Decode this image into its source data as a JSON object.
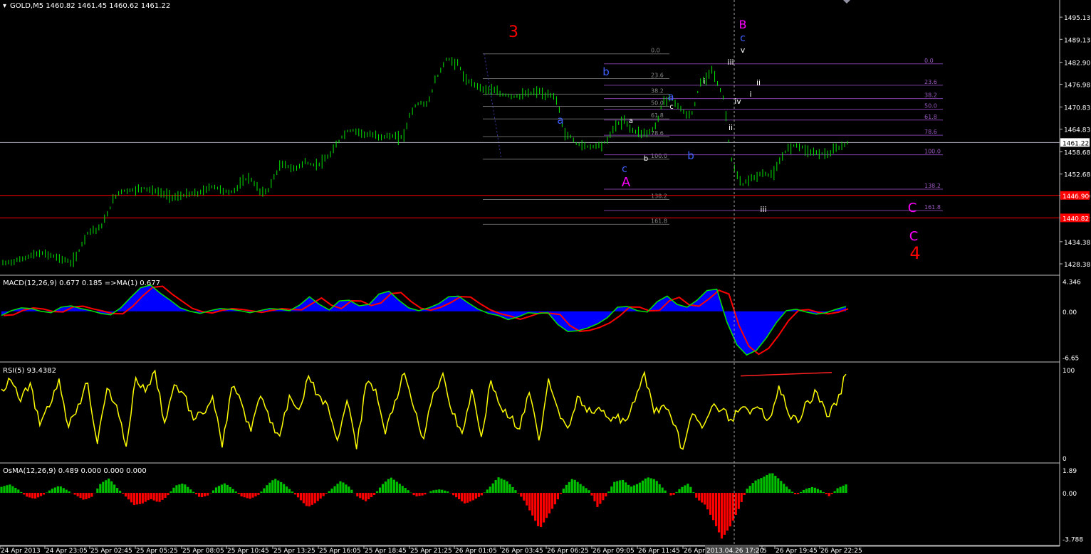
{
  "colors": {
    "background": "#000000",
    "grid": "#c0c0c0",
    "bar": "#00e600",
    "price_line": "#c0c0c0",
    "level_line": "#ff0000",
    "fib_red": "#7b3fa0",
    "fib_grey": "#6a6a6a",
    "macd_hist": "#0000ff",
    "macd_main": "#00e600",
    "macd_signal": "#ff0000",
    "rsi": "#ffff00",
    "osma_pos": "#00c000",
    "osma_neg": "#ff0000",
    "wave_red": "#ff0000",
    "wave_magenta": "#ff00ff",
    "wave_blue": "#4060ff",
    "wave_white": "#ffffff",
    "label_bg": "#ff0000"
  },
  "header": {
    "main": "GOLD,M5  1460.82 1461.45 1460.62 1461.22",
    "macd": "MACD(12,26,9) 0.677 0.185  =>MA(1) 0.677",
    "rsi": "RSI(5) 93.4382",
    "osma": "OsMA(12,26,9) 0.489 0.000 0.000 0.000"
  },
  "chart_data": [
    {
      "type": "bar",
      "panel": "price",
      "symbol": "GOLD",
      "timeframe": "M5",
      "ylim": [
        1425.5,
        1499.0
      ],
      "y_ticks": [
        "1495.13",
        "1489.13",
        "1482.90",
        "1476.98",
        "1470.83",
        "1464.83",
        "1458.68",
        "1452.68",
        "1446.90",
        "1440.82",
        "1434.38",
        "1428.38"
      ],
      "current_price": "1461.22",
      "levels": [
        {
          "value": 1446.9,
          "label": "1446.90"
        },
        {
          "value": 1440.82,
          "label": "1440.82"
        }
      ],
      "x_ticks": [
        "24 Apr 2013",
        "24 Apr 23:05",
        "25 Apr 02:45",
        "25 Apr 05:25",
        "25 Apr 08:05",
        "25 Apr 10:45",
        "25 Apr 13:25",
        "25 Apr 16:05",
        "25 Apr 18:45",
        "25 Apr 21:25",
        "26 Apr 01:05",
        "26 Apr 03:45",
        "26 Apr 06:25",
        "26 Apr 09:05",
        "26 Apr 11:45",
        "26 Apr",
        "2013.04.26 17:20",
        "5",
        "26 Apr 19:45",
        "26 Apr 22:25"
      ],
      "close_path": [
        1428.5,
        1428.8,
        1429.2,
        1429.6,
        1430.3,
        1430.8,
        1431.2,
        1431.0,
        1430.6,
        1430.0,
        1429.5,
        1428.6,
        1430.5,
        1434.5,
        1437.5,
        1437.5,
        1438.5,
        1442.0,
        1446.0,
        1448.0,
        1448.2,
        1448.3,
        1448.6,
        1448.9,
        1448.4,
        1447.9,
        1447.4,
        1446.8,
        1446.4,
        1446.8,
        1447.2,
        1447.3,
        1447.6,
        1448.6,
        1449.4,
        1448.8,
        1448.0,
        1447.7,
        1449.0,
        1450.8,
        1451.9,
        1449.5,
        1447.6,
        1448.2,
        1451.8,
        1455.0,
        1455.2,
        1453.8,
        1454.8,
        1456.0,
        1455.2,
        1455.2,
        1456.2,
        1457.6,
        1460.2,
        1462.8,
        1464.4,
        1464.5,
        1464.0,
        1463.3,
        1463.2,
        1462.8,
        1462.9,
        1463.0,
        1462.5,
        1462.9,
        1468.6,
        1471.4,
        1472.0,
        1471.5,
        1477.5,
        1480.7,
        1484.0,
        1483.0,
        1482.3,
        1477.8,
        1477.5,
        1476.6,
        1475.5,
        1475.7,
        1474.9,
        1474.1,
        1474.0,
        1473.6,
        1473.9,
        1474.4,
        1474.6,
        1475.2,
        1473.6,
        1474.1,
        1472.5,
        1463.6,
        1462.9,
        1461.0,
        1460.4,
        1460.1,
        1460.3,
        1460.6,
        1461.6,
        1465.0,
        1466.5,
        1467.1,
        1464.5,
        1464.1,
        1463.8,
        1464.1,
        1465.8,
        1472.2,
        1473.3,
        1472.2,
        1470.3,
        1468.3,
        1469.5,
        1477.0,
        1478.5,
        1481.4,
        1476.7,
        1472.8,
        1458.0,
        1452.2,
        1449.7,
        1451.2,
        1451.8,
        1452.9,
        1452.5,
        1452.7,
        1455.8,
        1459.1,
        1460.2,
        1460.7,
        1459.5,
        1458.7,
        1458.5,
        1458.3,
        1457.9,
        1459.4,
        1460.0,
        1461.2
      ],
      "fib_left": {
        "levels": [
          0.0,
          23.6,
          38.2,
          50.0,
          61.8,
          78.6,
          100.0,
          138.2,
          161.8
        ],
        "labels": [
          "0.0",
          "23.6",
          "38.2",
          "50.0",
          "61.8",
          "78.6",
          "100.0",
          "138.2",
          "161.8"
        ],
        "prices": [
          1485.2,
          1478.5,
          1474.3,
          1471.0,
          1467.6,
          1462.8,
          1456.7,
          1445.8,
          1439.1
        ]
      },
      "fib_right": {
        "levels": [
          0.0,
          23.6,
          38.2,
          50.0,
          61.8,
          78.6,
          100.0,
          138.2,
          161.8
        ],
        "labels": [
          "0.0",
          "23.6",
          "38.2",
          "50.0",
          "61.8",
          "78.6",
          "100.0",
          "138.2",
          "161.8"
        ],
        "prices": [
          1482.5,
          1476.7,
          1473.1,
          1470.2,
          1467.3,
          1463.2,
          1457.9,
          1448.6,
          1442.8
        ]
      },
      "wave_labels": [
        {
          "text": "3",
          "color": "red"
        },
        {
          "text": "B",
          "color": "magenta"
        },
        {
          "text": "c",
          "color": "blue"
        },
        {
          "text": "v",
          "color": "white"
        },
        {
          "text": "iii",
          "color": "white"
        },
        {
          "text": "ii",
          "color": "white"
        },
        {
          "text": "i",
          "color": "white"
        },
        {
          "text": "iv",
          "color": "white"
        },
        {
          "text": "i",
          "color": "white"
        },
        {
          "text": "ii",
          "color": "white"
        },
        {
          "text": "iii",
          "color": "white"
        },
        {
          "text": "b",
          "color": "blue"
        },
        {
          "text": "a",
          "color": "blue"
        },
        {
          "text": "a",
          "color": "blue"
        },
        {
          "text": "a",
          "color": "white"
        },
        {
          "text": "c",
          "color": "white"
        },
        {
          "text": "b",
          "color": "white"
        },
        {
          "text": "b",
          "color": "blue"
        },
        {
          "text": "c",
          "color": "blue"
        },
        {
          "text": "A",
          "color": "magenta"
        },
        {
          "text": "C",
          "color": "magenta"
        },
        {
          "text": "C",
          "color": "magenta"
        },
        {
          "text": "4",
          "color": "red"
        }
      ]
    },
    {
      "type": "area",
      "panel": "macd",
      "name": "MACD(12,26,9)",
      "ylim": [
        -7.2,
        4.9
      ],
      "y_ticks": [
        "4.346",
        "0.00",
        "-6.65"
      ],
      "values": [
        -0.6,
        0.1,
        0.5,
        0.4,
        0.0,
        -0.2,
        0.6,
        0.8,
        0.4,
        0.1,
        -0.3,
        -0.5,
        0.5,
        2.0,
        3.4,
        3.8,
        2.6,
        1.6,
        0.5,
        0.0,
        -0.3,
        0.1,
        0.4,
        0.3,
        0.1,
        -0.2,
        0.1,
        0.4,
        0.3,
        0.1,
        0.9,
        2.1,
        1.0,
        0.2,
        1.5,
        1.6,
        0.8,
        1.0,
        2.5,
        2.9,
        1.6,
        0.5,
        0.1,
        0.5,
        1.1,
        2.1,
        2.2,
        1.2,
        0.3,
        -0.3,
        -0.6,
        -1.2,
        -0.8,
        -0.2,
        -0.3,
        -0.2,
        -1.9,
        -2.9,
        -2.8,
        -2.4,
        -1.8,
        -0.9,
        0.6,
        0.7,
        0.1,
        -0.1,
        1.4,
        2.2,
        1.0,
        0.6,
        1.6,
        3.0,
        3.2,
        -1.5,
        -4.8,
        -6.3,
        -5.6,
        -3.8,
        -1.6,
        0.1,
        0.3,
        -0.1,
        -0.4,
        -0.2,
        0.3,
        0.7
      ]
    },
    {
      "type": "line",
      "panel": "rsi",
      "name": "RSI(5)",
      "ylim": [
        0,
        100
      ],
      "y_ticks": [
        "100",
        "0"
      ],
      "values": [
        78,
        88,
        64,
        85,
        37,
        58,
        90,
        35,
        61,
        85,
        16,
        79,
        60,
        13,
        91,
        75,
        99,
        40,
        83,
        73,
        43,
        50,
        70,
        12,
        80,
        63,
        30,
        70,
        40,
        25,
        71,
        55,
        93,
        72,
        60,
        20,
        65,
        10,
        84,
        78,
        27,
        65,
        96,
        55,
        22,
        74,
        96,
        50,
        28,
        78,
        24,
        88,
        58,
        45,
        33,
        74,
        20,
        90,
        55,
        34,
        70,
        52,
        55,
        47,
        45,
        42,
        64,
        97,
        51,
        60,
        38,
        10,
        50,
        34,
        58,
        54,
        44,
        56,
        50,
        56,
        45,
        82,
        50,
        40,
        65,
        74,
        47,
        60,
        95
      ],
      "trendline": [
        {
          "x": 1040,
          "y": 93
        },
        {
          "x": 1168,
          "y": 97
        }
      ]
    },
    {
      "type": "bar",
      "panel": "osma",
      "name": "OsMA(12,26,9)",
      "ylim": [
        -4.3,
        2.3
      ],
      "y_ticks": [
        "1.89",
        "0.00",
        "-3.788"
      ],
      "values": [
        0.5,
        0.7,
        0.3,
        -0.3,
        -0.5,
        -0.2,
        0.3,
        0.6,
        0.2,
        -0.2,
        -0.6,
        -0.3,
        0.8,
        1.2,
        0.4,
        -0.3,
        -1.0,
        -0.9,
        -0.5,
        -0.8,
        -0.3,
        0.6,
        0.8,
        0.2,
        -0.4,
        -0.2,
        0.5,
        0.8,
        0.3,
        -0.3,
        -0.5,
        -0.2,
        0.6,
        1.2,
        0.8,
        0.2,
        -0.5,
        -1.2,
        -0.8,
        -0.2,
        0.4,
        1.0,
        0.5,
        -0.3,
        -0.7,
        -0.2,
        0.7,
        1.3,
        0.8,
        0.3,
        -0.3,
        -0.2,
        0.2,
        0.3,
        0.1,
        -0.4,
        -0.9,
        -0.6,
        -0.2,
        0.5,
        1.3,
        1.0,
        0.3,
        -0.5,
        -1.7,
        -3.0,
        -1.9,
        -0.8,
        0.5,
        1.2,
        0.7,
        0.2,
        -1.2,
        -0.3,
        0.9,
        1.1,
        0.5,
        0.8,
        1.3,
        1.1,
        0.3,
        -0.3,
        0.4,
        0.8,
        -0.5,
        -1.0,
        -2.3,
        -3.8,
        -2.8,
        -1.4,
        0.3,
        1.0,
        1.3,
        1.7,
        1.1,
        0.4,
        -0.2,
        0.3,
        0.5,
        0.2,
        -0.3,
        0.4,
        0.7
      ]
    }
  ]
}
